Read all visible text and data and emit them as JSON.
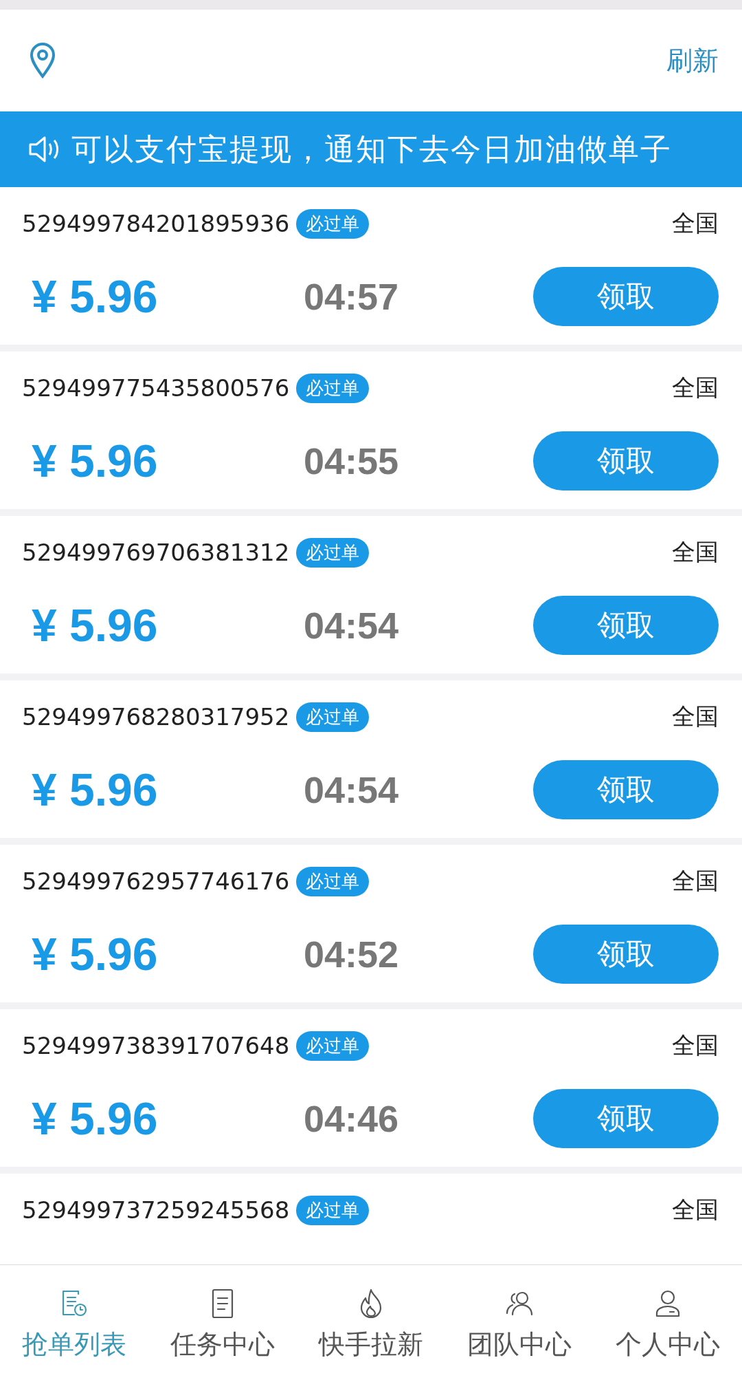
{
  "header": {
    "refresh_label": "刷新"
  },
  "notice": {
    "text": "可以支付宝提现，通知下去今日加油做单子"
  },
  "orders": [
    {
      "kind": "full",
      "id": "529499784201895936",
      "tag": "必过单",
      "region": "全国",
      "price": "¥ 5.96",
      "time": "04:57",
      "button": "领取"
    },
    {
      "kind": "full",
      "id": "529499775435800576",
      "tag": "必过单",
      "region": "全国",
      "price": "¥ 5.96",
      "time": "04:55",
      "button": "领取"
    },
    {
      "kind": "full",
      "id": "529499769706381312",
      "tag": "必过单",
      "region": "全国",
      "price": "¥ 5.96",
      "time": "04:54",
      "button": "领取"
    },
    {
      "kind": "full",
      "id": "529499768280317952",
      "tag": "必过单",
      "region": "全国",
      "price": "¥ 5.96",
      "time": "04:54",
      "button": "领取"
    },
    {
      "kind": "full",
      "id": "529499762957746176",
      "tag": "必过单",
      "region": "全国",
      "price": "¥ 5.96",
      "time": "04:52",
      "button": "领取"
    },
    {
      "kind": "full",
      "id": "529499738391707648",
      "tag": "必过单",
      "region": "全国",
      "price": "¥ 5.96",
      "time": "04:46",
      "button": "领取"
    },
    {
      "kind": "partial",
      "id": "529499737259245568",
      "tag": "必过单",
      "region": "全国"
    }
  ],
  "nav": [
    {
      "label": "抢单列表",
      "kind": "list",
      "selected": true
    },
    {
      "label": "任务中心",
      "kind": "doc",
      "selected": false
    },
    {
      "label": "快手拉新",
      "kind": "flame",
      "selected": false
    },
    {
      "label": "团队中心",
      "kind": "team",
      "selected": false
    },
    {
      "label": "个人中心",
      "kind": "user",
      "selected": false
    }
  ]
}
